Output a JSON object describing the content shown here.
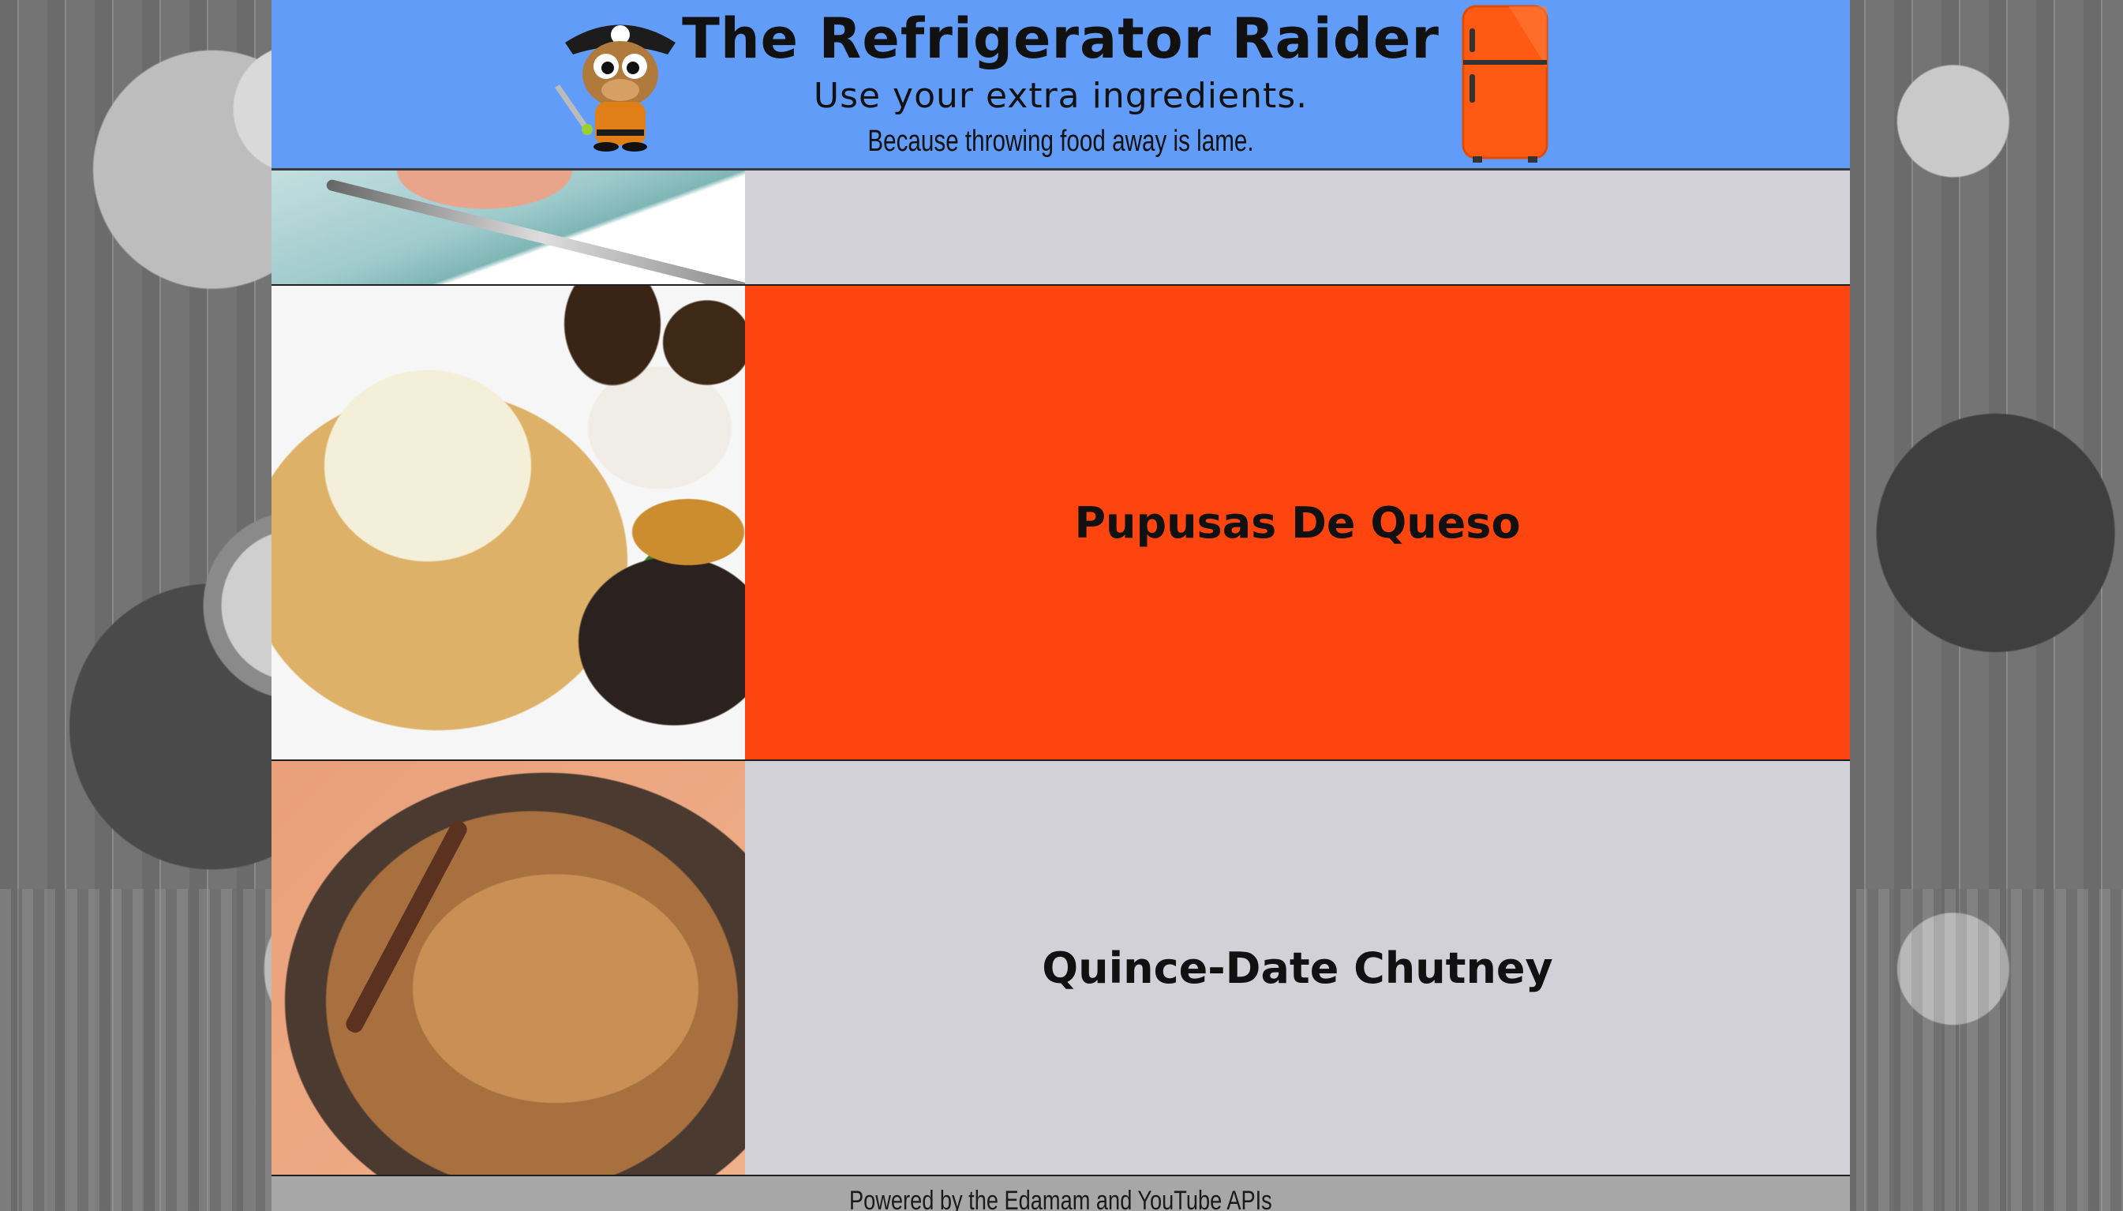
{
  "header": {
    "title": "The Refrigerator Raider",
    "tagline": "Use your extra ingredients.",
    "subtagline": "Because throwing food away is lame."
  },
  "recipes": [
    {
      "title": ""
    },
    {
      "title": "Pupusas De Queso"
    },
    {
      "title": "Quince-Date Chutney"
    }
  ],
  "footer": {
    "text": "Powered by the Edamam and YouTube APIs"
  },
  "colors": {
    "header_bg": "#619df8",
    "accent_row": "#fe450f",
    "row_bg": "#d3d1d8",
    "footer_bg": "#a7a7a7"
  }
}
